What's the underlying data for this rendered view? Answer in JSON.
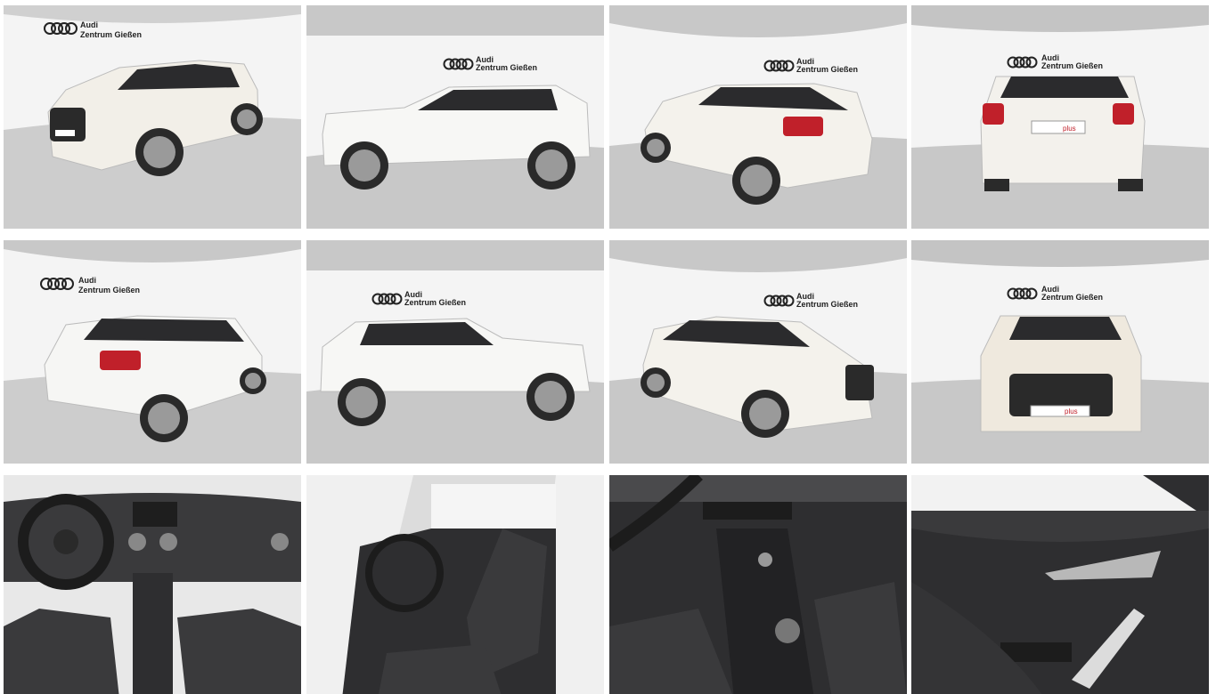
{
  "gallery": {
    "showroom_brand": "Audi",
    "showroom_location": "Zentrum Gießen",
    "plate_text": "plus",
    "photos": [
      {
        "view": "front-left-three-quarter",
        "body_color": "#f2efe8"
      },
      {
        "view": "left-side",
        "body_color": "#f7f7f5"
      },
      {
        "view": "rear-left-three-quarter",
        "body_color": "#f4f2ec"
      },
      {
        "view": "rear",
        "body_color": "#f3f1ec"
      },
      {
        "view": "rear-left-three-quarter-close",
        "body_color": "#f6f6f4"
      },
      {
        "view": "left-side-alt",
        "body_color": "#f7f7f5"
      },
      {
        "view": "front-right-three-quarter",
        "body_color": "#f4f2ec"
      },
      {
        "view": "front",
        "body_color": "#efe9de"
      },
      {
        "view": "cockpit"
      },
      {
        "view": "driver-seat"
      },
      {
        "view": "center-console"
      },
      {
        "view": "door-panel"
      }
    ]
  },
  "colors": {
    "wall": "#f4f4f4",
    "ceiling": "#bdbdbd",
    "floor": "#cfcfcf",
    "taillight": "#c0202a",
    "tire": "#2a2a2a",
    "interior_dark": "#2e2e30",
    "leather": "#3a3a3c"
  }
}
